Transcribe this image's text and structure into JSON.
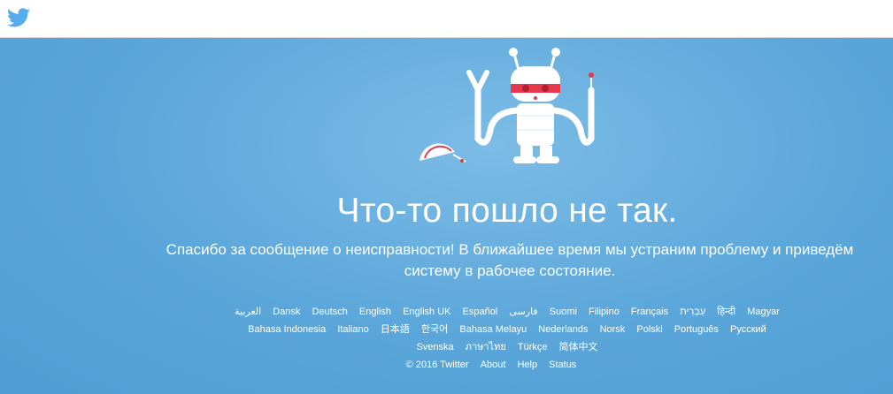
{
  "header": {
    "logo_icon": "twitter-bird-icon",
    "brand_color": "#55acee"
  },
  "error": {
    "illustration_icon": "robot-icon",
    "title": "Что-то пошло не так.",
    "message_line1": "Спасибо за сообщение о неисправности! В ближайшее время мы устраним проблему и приведём",
    "message_line2": "систему в рабочее состояние."
  },
  "languages": [
    "العربية",
    "Dansk",
    "Deutsch",
    "English",
    "English UK",
    "Español",
    "فارسی",
    "Suomi",
    "Filipino",
    "Français",
    "עִבְרִית",
    "हिन्दी",
    "Magyar",
    "Bahasa Indonesia",
    "Italiano",
    "日本語",
    "한국어",
    "Bahasa Melayu",
    "Nederlands",
    "Norsk",
    "Polski",
    "Português",
    "Русский",
    "Svenska",
    "ภาษาไทย",
    "Türkçe",
    "简体中文"
  ],
  "footer": {
    "copyright": "© 2016 Twitter",
    "about": "About",
    "help": "Help",
    "status": "Status"
  },
  "colors": {
    "background": "#5aa6da",
    "text": "#ffffff"
  }
}
